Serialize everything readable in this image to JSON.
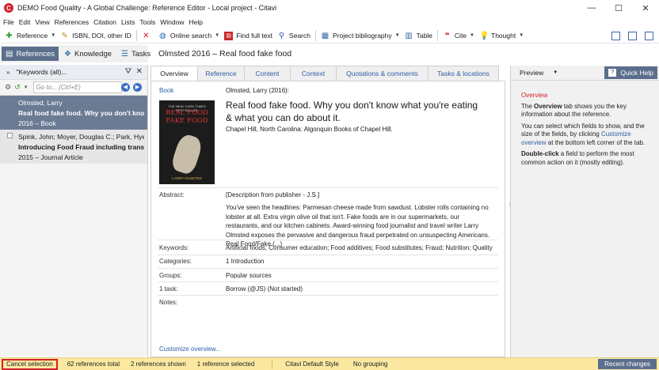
{
  "window": {
    "title": "DEMO Food Quality - A Global Challenge: Reference Editor - Local project - Citavi",
    "app_icon_letter": "C",
    "minimize": "—",
    "maximize": "☐",
    "close": "✕"
  },
  "menu": [
    "File",
    "Edit",
    "View",
    "References",
    "Citation",
    "Lists",
    "Tools",
    "Window",
    "Help"
  ],
  "toolbar": {
    "reference": "Reference",
    "isbn": "ISBN, DOI, other ID",
    "online_search": "Online search",
    "find_full_text": "Find full text",
    "search": "Search",
    "project_bibliography": "Project bibliography",
    "table": "Table",
    "cite": "Cite",
    "thought": "Thought"
  },
  "nav_tabs": {
    "references": "References",
    "knowledge": "Knowledge",
    "tasks": "Tasks"
  },
  "left_panel": {
    "header_title": "\"Keywords (all)...",
    "search_placeholder": "Go to... (Ctrl+E)",
    "references": [
      {
        "authors": "Olmsted, Larry",
        "title": "Real food fake food. Why you don't know w",
        "meta": "2016 – Book"
      },
      {
        "authors": "Spink, John; Moyer, Douglas C.; Park, Hyeonh",
        "title": "Introducing Food Fraud including translation",
        "meta": "2015 – Journal Article"
      }
    ]
  },
  "reference_header": "Olmsted 2016 – Real food fake food",
  "tabs": [
    "Overview",
    "Reference",
    "Content",
    "Context",
    "Quotations & comments",
    "Tasks & locations"
  ],
  "overview": {
    "type": "Book",
    "citation": "Olmsted, Larry (2016):",
    "title": "Real food fake food. Why you don't know what you're eating & what you can do about it.",
    "place": "Chapel Hill, North Carolina: Algonquin Books of Chapel Hill.",
    "cover": {
      "top_line": "THE NEW YORK TIMES BESTSELLER",
      "title": "REAL FOOD FAKE FOOD",
      "author": "LARRY OLMSTED"
    },
    "abstract_label": "Abstract:",
    "abstract_source": "[Description from publisher - J.S.]",
    "abstract_text": "You've seen the headlines: Parmesan cheese made from sawdust. Lobster rolls containing no lobster at all. Extra virgin olive oil that isn't. Fake foods are in our supermarkets, our restaurants, and our kitchen cabinets. Award-winning food journalist and travel writer Larry Olmsted exposes the pervasive and dangerous fraud perpetrated on unsuspecting Americans. Real Food/Fake (...)",
    "keywords_label": "Keywords:",
    "keywords": "Artificial foods; Consumer education; Food additives; Food substitutes; Fraud; Nutrition; Quality",
    "categories_label": "Categories:",
    "categories": "1 Introduction",
    "groups_label": "Groups:",
    "groups": "Popular sources",
    "task_label": "1 task:",
    "task": "Borrow (@JS) (Not started)",
    "notes_label": "Notes:",
    "customize": "Customize overview..."
  },
  "right_panel": {
    "preview_label": "Preview",
    "quick_help": "Quick Help",
    "help_title": "Overview",
    "p1_pre": "The ",
    "p1_bold": "Overview",
    "p1_post": " tab shows you the key information about the reference.",
    "p2_pre": "You can select which fields to show, and the size of the fields, by clicking ",
    "p2_link": "Customize overview",
    "p2_post": " at the bottom left corner of the tab.",
    "p3_bold": "Double-click",
    "p3_post": " a field to perform the most common action on it (mostly editing)."
  },
  "status": {
    "cancel_selection": "Cancel selection",
    "total": "62 references total",
    "shown": "2 references shown",
    "selected": "1 reference selected",
    "style": "Citavi Default Style",
    "grouping": "No grouping",
    "recent_changes": "Recent changes"
  },
  "colors": {
    "accent_navy": "#5b6e8c",
    "link_blue": "#2d5ea8",
    "help_red": "#d4202c",
    "status_yellow": "#fbe9a2"
  }
}
